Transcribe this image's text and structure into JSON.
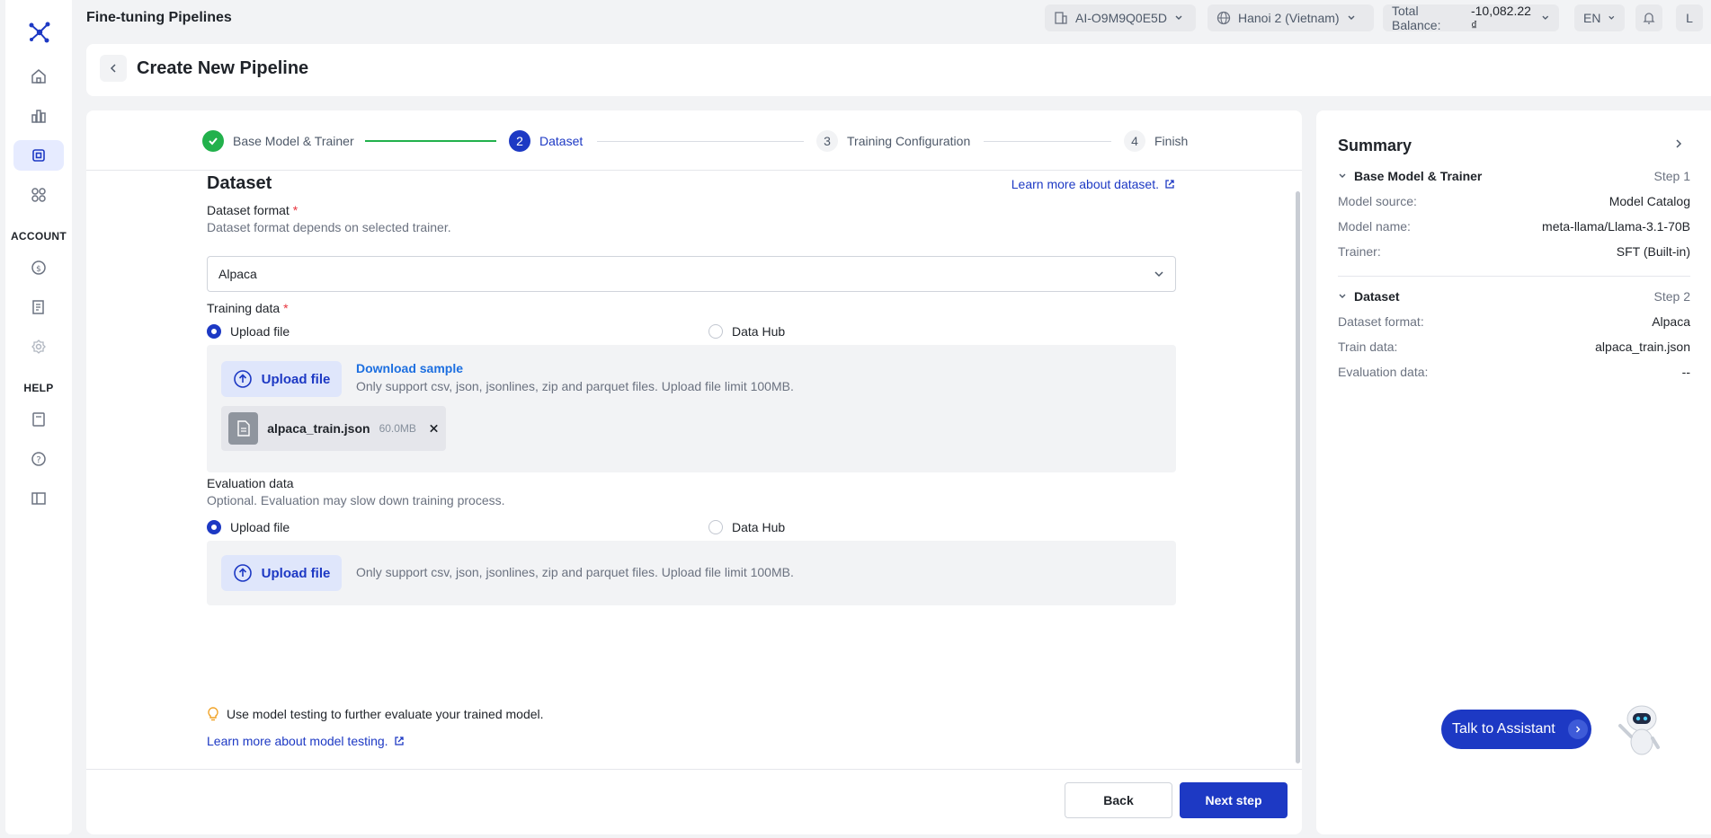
{
  "app": {
    "title": "Fine-tuning Pipelines"
  },
  "topbar": {
    "project": "AI-O9M9Q0E5D",
    "region": "Hanoi 2 (Vietnam)",
    "balance_label": "Total Balance:",
    "balance_value": "-10,082.22 ₫",
    "language": "EN",
    "user_initial": "L"
  },
  "sidebar": {
    "account_label": "ACCOUNT",
    "help_label": "HELP"
  },
  "header": {
    "title": "Create New Pipeline"
  },
  "steps": [
    {
      "num": "1",
      "label": "Base Model & Trainer",
      "state": "done"
    },
    {
      "num": "2",
      "label": "Dataset",
      "state": "active"
    },
    {
      "num": "3",
      "label": "Training Configuration",
      "state": "todo"
    },
    {
      "num": "4",
      "label": "Finish",
      "state": "todo"
    }
  ],
  "dataset": {
    "title": "Dataset",
    "learn_more": "Learn more about dataset.",
    "format_label": "Dataset format",
    "format_hint": "Dataset format depends on selected trainer.",
    "format_value": "Alpaca",
    "training_label": "Training data",
    "radio_upload": "Upload file",
    "radio_hub": "Data Hub",
    "upload_btn": "Upload file",
    "download_sample": "Download sample",
    "upload_note": "Only support csv, json, jsonlines, zip and parquet files. Upload file limit 100MB.",
    "file_name": "alpaca_train.json",
    "file_size": "60.0MB",
    "eval_label": "Evaluation data",
    "eval_hint": "Optional. Evaluation may slow down training process.",
    "tip": "Use model testing to further evaluate your trained model.",
    "tip_link": "Learn more about model testing."
  },
  "footer": {
    "back": "Back",
    "next": "Next step"
  },
  "summary": {
    "title": "Summary",
    "section1": {
      "title": "Base Model & Trainer",
      "step": "Step 1",
      "rows": [
        {
          "k": "Model source:",
          "v": "Model Catalog"
        },
        {
          "k": "Model name:",
          "v": "meta-llama/Llama-3.1-70B"
        },
        {
          "k": "Trainer:",
          "v": "SFT (Built-in)"
        }
      ]
    },
    "section2": {
      "title": "Dataset",
      "step": "Step 2",
      "rows": [
        {
          "k": "Dataset format:",
          "v": "Alpaca"
        },
        {
          "k": "Train data:",
          "v": "alpaca_train.json"
        },
        {
          "k": "Evaluation data:",
          "v": "--"
        }
      ]
    }
  },
  "assistant": {
    "label": "Talk to Assistant"
  },
  "colors": {
    "primary": "#1d39c4",
    "success": "#22b14c",
    "required": "#e8343e"
  }
}
